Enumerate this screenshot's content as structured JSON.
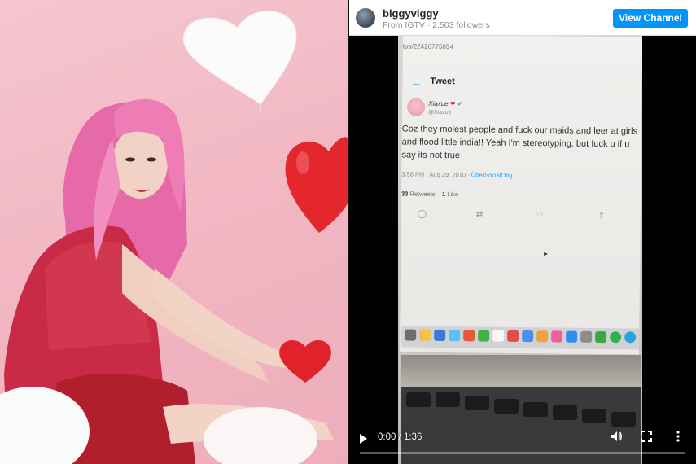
{
  "photo": {
    "description_icon": "portrait-photo"
  },
  "header": {
    "channel_name": "biggyviggy",
    "source": "From IGTV",
    "separator": "·",
    "followers": "2,503 followers",
    "view_channel_label": "View Channel"
  },
  "video_content": {
    "url_text": "tus/22426775034",
    "back_arrow": "←",
    "tweet_title": "Tweet",
    "author_name": "Xiaxue",
    "author_heart": "❤",
    "author_verified": "✔",
    "handle": "@Xiaxue",
    "body": "Coz they molest people and fuck our maids and leer at girls and flood little india!! Yeah I'm stereotyping, but fuck u if u say its not true",
    "time_date": "3:58 PM · Aug 29, 2010 · ",
    "source_app": "ÜberSocialOrig",
    "retweets_count": "33",
    "retweets_label": "Retweets",
    "likes_count": "1",
    "likes_label": "Like",
    "actions": [
      "reply-icon",
      "retweet-icon",
      "like-icon",
      "share-icon"
    ],
    "action_glyphs": [
      "◯",
      "⇄",
      "♡",
      "⇪"
    ]
  },
  "player": {
    "current_time": "0:00",
    "duration": "1:36",
    "time_display": "0:00 / 1:36",
    "progress_fraction": 0.0
  },
  "colors": {
    "accent": "#0095f6",
    "twitter_blue": "#1da1f2",
    "background_pink": "#f2b8c4"
  }
}
